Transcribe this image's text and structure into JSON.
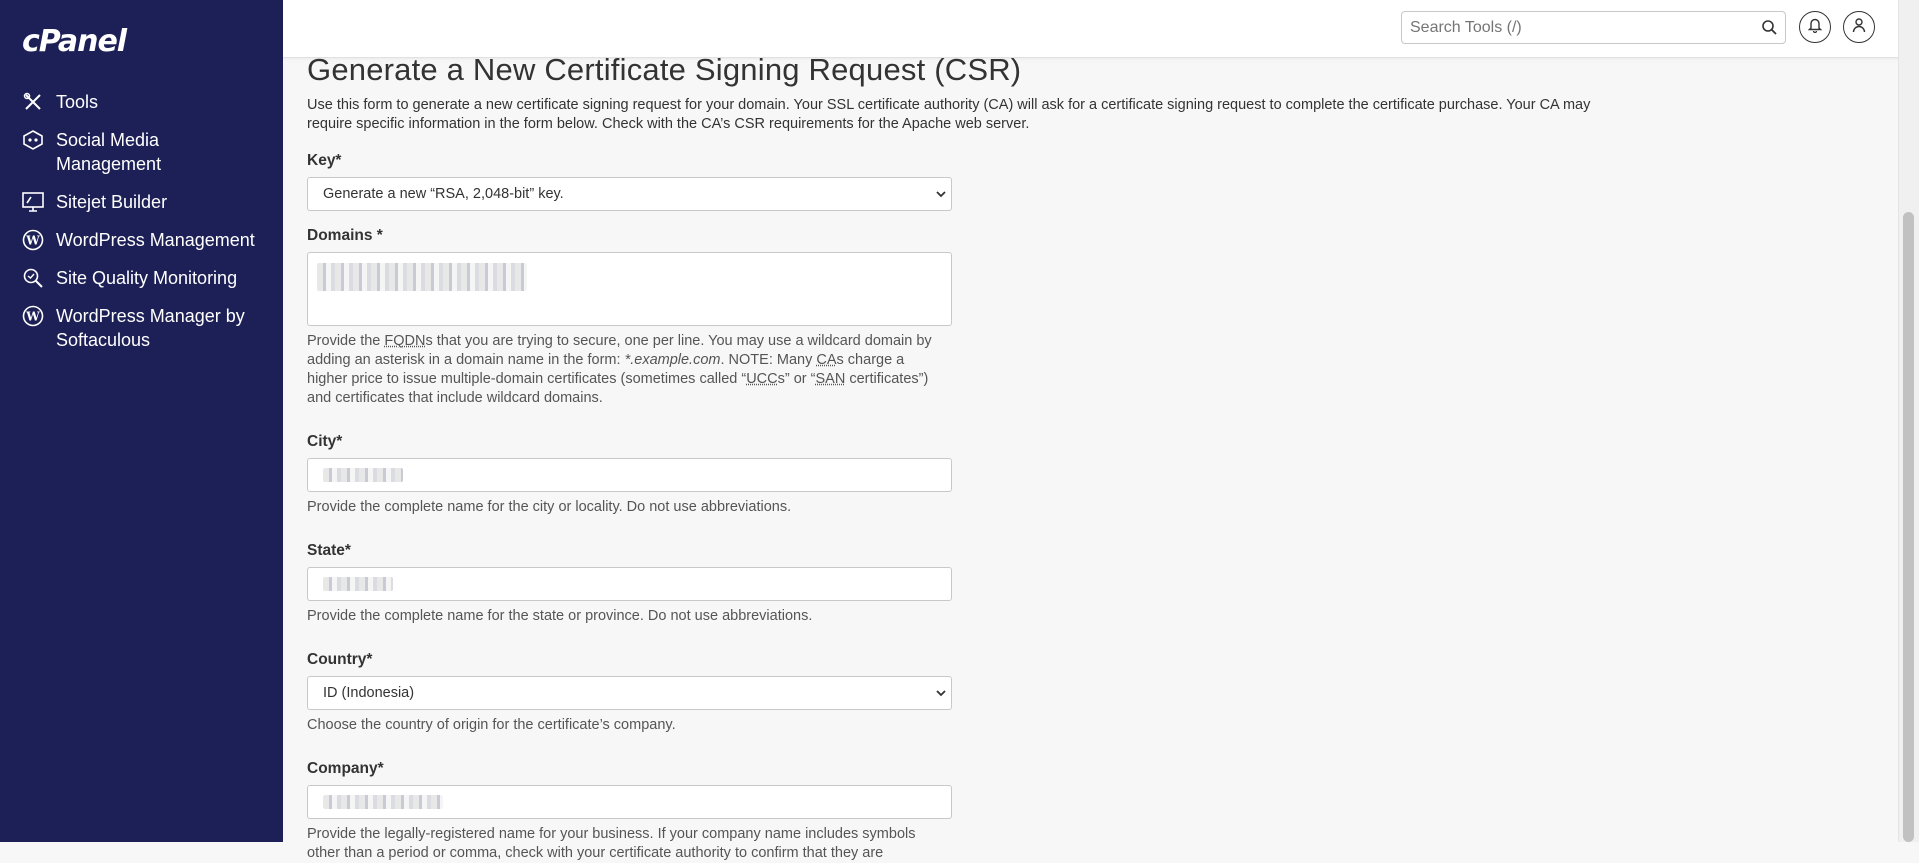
{
  "app": {
    "logo": "cPanel"
  },
  "sidebar": {
    "items": [
      {
        "label": "Tools",
        "icon": "tools-icon"
      },
      {
        "label": "Social Media Management",
        "icon": "social-media-icon"
      },
      {
        "label": "Sitejet Builder",
        "icon": "sitejet-icon"
      },
      {
        "label": "WordPress Management",
        "icon": "wordpress-icon"
      },
      {
        "label": "Site Quality Monitoring",
        "icon": "search-quality-icon"
      },
      {
        "label": "WordPress Manager by Softaculous",
        "icon": "wordpress-icon"
      }
    ]
  },
  "header": {
    "search_placeholder": "Search Tools (/)"
  },
  "page": {
    "title": "Generate a New Certificate Signing Request (CSR)",
    "intro": "Use this form to generate a new certificate signing request for your domain. Your SSL certificate authority (CA) will ask for a certificate signing request to complete the certificate purchase. Your CA may require specific information in the form below. Check with the CA’s CSR requirements for the Apache web server."
  },
  "form": {
    "key": {
      "label": "Key*",
      "value": "Generate a new “RSA, 2,048-bit” key."
    },
    "domains": {
      "label": "Domains *",
      "help_1": "Provide the ",
      "help_fqdn": "FQDN",
      "help_2": "s that you are trying to secure, one per line. You may use a wildcard domain by adding an asterisk in a domain name in the form: ",
      "help_example": "*.example.com",
      "help_3": ". NOTE: Many ",
      "help_ca": "CA",
      "help_4": "s charge a higher price to issue multiple-domain certificates (sometimes called “",
      "help_ucc": "UCC",
      "help_5": "s” or “",
      "help_san": "SAN",
      "help_6": " certificates”) and certificates that include wildcard domains."
    },
    "city": {
      "label": "City*",
      "help": "Provide the complete name for the city or locality. Do not use abbreviations."
    },
    "state": {
      "label": "State*",
      "help": "Provide the complete name for the state or province. Do not use abbreviations."
    },
    "country": {
      "label": "Country*",
      "value": "ID (Indonesia)",
      "help": "Choose the country of origin for the certificate’s company."
    },
    "company": {
      "label": "Company*",
      "help": "Provide the legally-registered name for your business. If your company name includes symbols other than a period or comma, check with your certificate authority to confirm that they are"
    }
  },
  "colors": {
    "sidebar_bg": "#1d2056",
    "page_bg": "#f7f7f7"
  }
}
